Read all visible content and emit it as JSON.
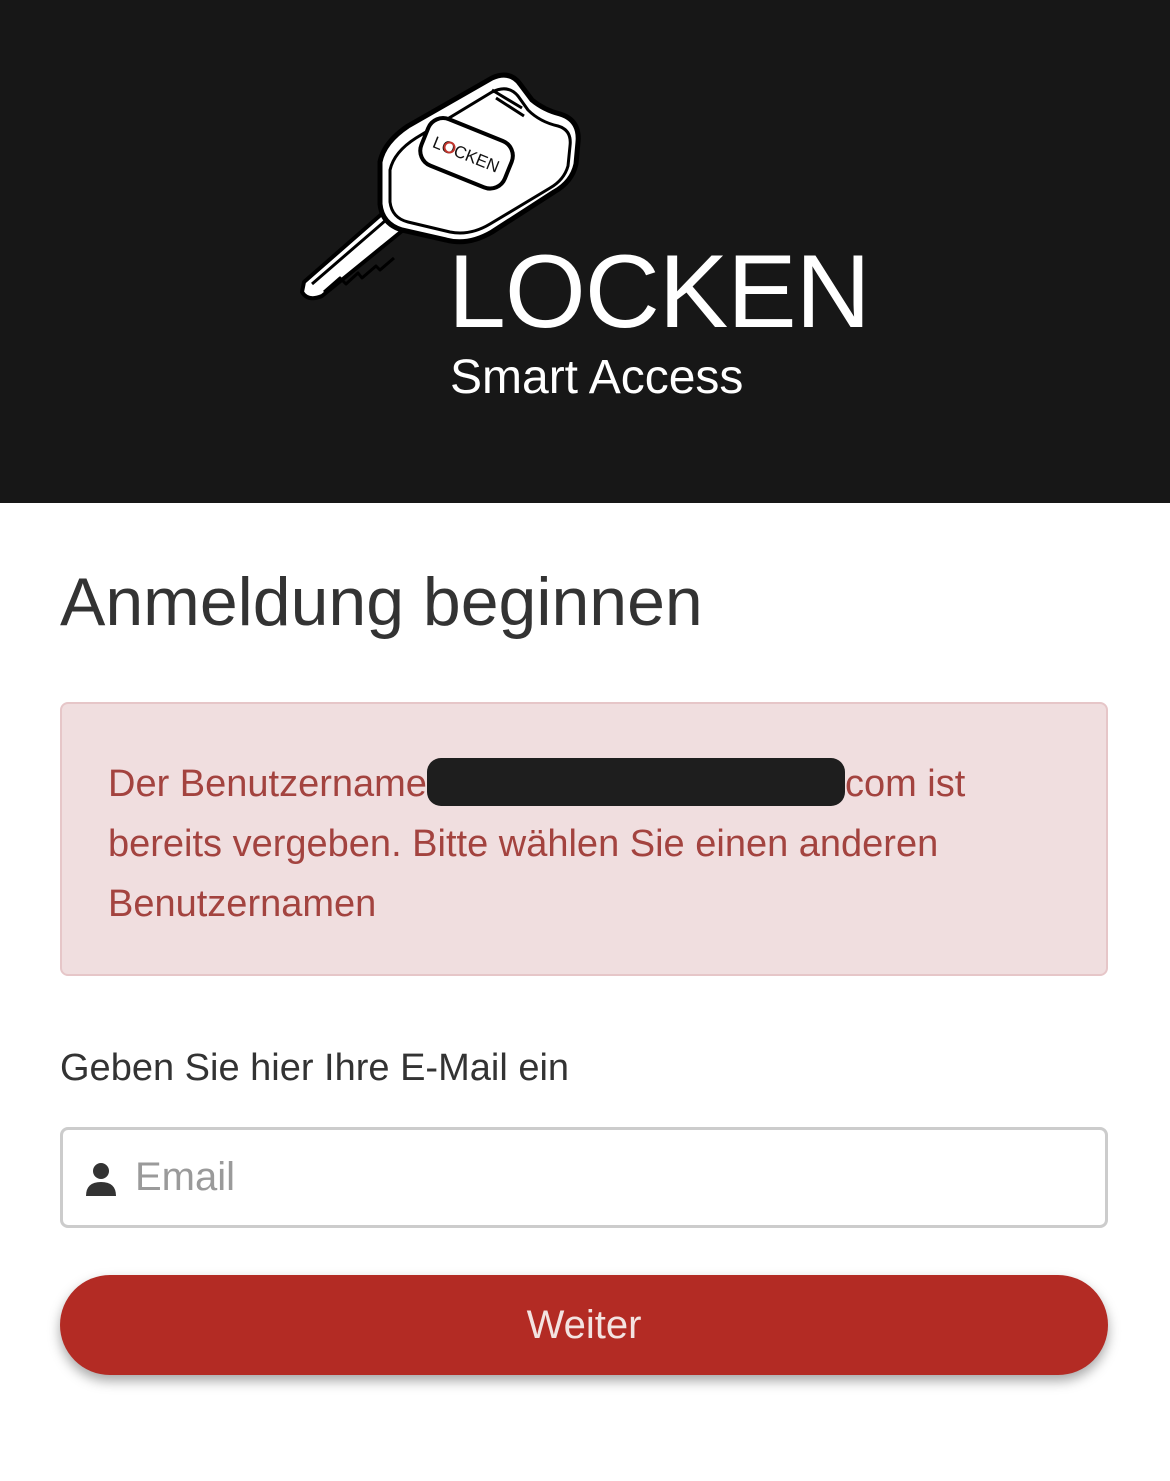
{
  "header": {
    "brand_name": "LOCKEN",
    "tagline": "Smart Access",
    "key_badge_text": "LOCKEN",
    "logo_icon": "car-key-icon"
  },
  "login": {
    "title": "Anmeldung beginnen",
    "error": {
      "prefix": "Der Benutzername",
      "suffix": "com ist bereits vergeben. Bitte wählen Sie einen anderen Benutzernamen"
    },
    "email_label": "Geben Sie hier Ihre E-Mail ein",
    "email_placeholder": "Email",
    "email_value": "",
    "email_icon": "user-icon",
    "submit_label": "Weiter"
  },
  "colors": {
    "header_bg": "#171717",
    "alert_bg": "#f0dedf",
    "alert_text": "#a3433f",
    "primary_button": "#b32b24"
  }
}
